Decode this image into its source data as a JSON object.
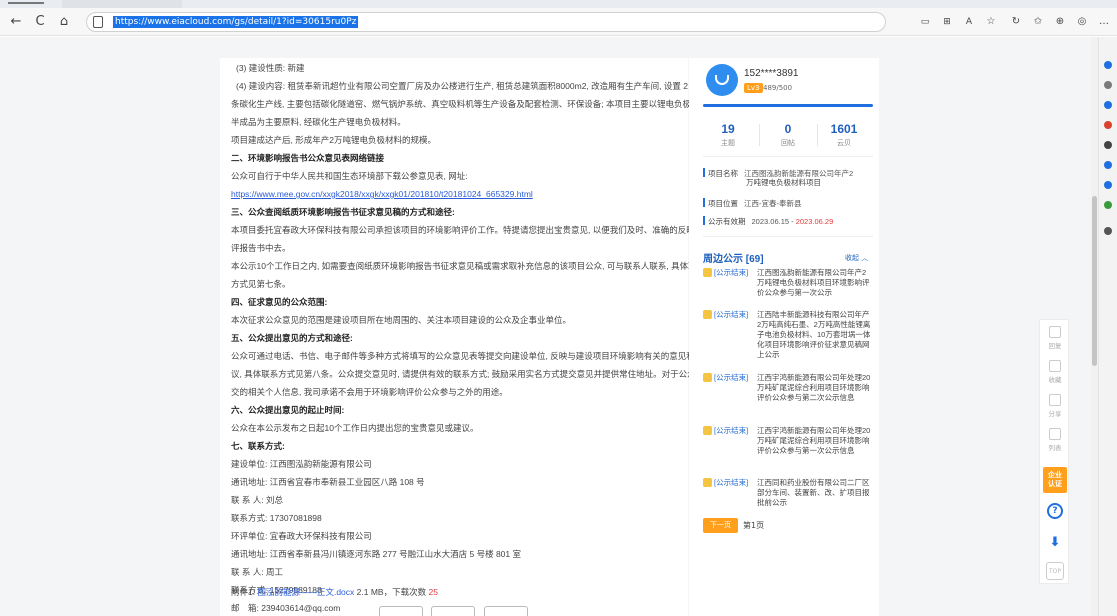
{
  "browser": {
    "url": "https://www.eiacloud.com/gs/detail/1?id=30615ru0Pz",
    "back": "←",
    "refresh": "C",
    "home": "⌂",
    "icons": [
      "reader-view-icon",
      "grid-icon",
      "read-aloud-icon",
      "favorite-star-icon",
      "refresh-ext-icon",
      "favorites-icon",
      "collections-icon",
      "more-icon"
    ]
  },
  "article": {
    "lines": [
      "(3) 建设性质: 新建",
      "(4) 建设内容: 租赁奉新讯超竹业有限公司空置厂房及办公楼进行生产, 租赁总建筑面积8000m2, 改造厢有生产车间, 设置 2",
      "条碳化生产线, 主要包括碳化隧道窑、燃气锅炉系统、真空吸料机等生产设备及配套检测、环保设备; 本项目主要以锂电负极材料",
      "半成品为主要原料, 经碳化生产锂电负极材料。",
      "项目建成达产后, 形成年产2万吨锂电负极材料的规模。",
      "二、环境影响报告书公众意见表网络链接",
      "公众可自行于中华人民共和国生态环境部下载公参意见表, 网址:",
      "https://www.mee.gov.cn/xxgk2018/xxgk/xxgk01/201810/t20181024_665329.html",
      "三、公众查阅纸质环境影响报告书征求意见稿的方式和途径:",
      "本项目委托宜春政大环保科技有限公司承担该项目的环境影响评价工作。特提请您提出宝贵意见, 以便我们及时、准确的反映到环",
      "评报告书中去。",
      "本公示10个工作日之内, 如需要查阅纸质环境影响报告书征求意见稿或需求取补充信息的该项目公众, 可与联系人联系, 具体联系",
      "方式见第七条。",
      "四、征求意见的公众范围:",
      "本次征求公众意见的范围是建设项目所在地周围的、关注本项目建设的公众及企事业单位。",
      "五、公众提出意见的方式和途径:",
      "公众可通过电话、书信、电子邮件等多种方式将填写的公众意见表等提交向建设单位, 反映与建设项目环境影响有关的意见和建",
      "议, 具体联系方式见第八条。公众提交意见时, 请提供有效的联系方式; 鼓励采用实名方式提交意见并提供常住地址。对于公众提",
      "交的相关个人信息, 我司承诺不会用于环境影响评价公众参与之外的用途。",
      "六、公众提出意见的起止时间:",
      "公众在本公示发布之日起10个工作日内提出您的宝贵意见或建议。",
      "七、联系方式:",
      "建设单位: 江西图泓韵新能源有限公司",
      "通讯地址: 江西省宜春市奉新县工业园区八路 108 号",
      "联 系 人: 刘总",
      "联系方式: 17307081898",
      "环评单位: 宜春政大环保科技有限公司",
      "通讯地址: 江西省奉新县冯川镇逐河东路 277 号融江山水大酒店 5 号楼 801 室",
      "联 系 人: 周工",
      "联系方式: 15279589188",
      "邮　箱: 239403614@qq.com"
    ],
    "attachment": {
      "prefix": "附件1:",
      "filename": "图泓韵能源——正文.docx",
      "meta": "2.1 MB，下载次数",
      "downloads": "25"
    }
  },
  "panel": {
    "username": "152****3891",
    "level": "Lv3",
    "score": "489/500",
    "stats": [
      {
        "num": "19",
        "label": "主题"
      },
      {
        "num": "0",
        "label": "回帖"
      },
      {
        "num": "1601",
        "label": "云贝"
      }
    ],
    "info": {
      "name_key": "项目名称",
      "name_val_1": "江西图泓韵新能源有限公司年产2",
      "name_val_2": "万吨锂电负极材料项目",
      "loc_key": "项目位置",
      "loc_val": "江西-宜春-奉新县",
      "period_key": "公示有效期",
      "period_start": "2023.06.15 - ",
      "period_end": "2023.06.29"
    },
    "nearby": {
      "title": "周边公示 [69]",
      "collapse": "收起 ︿",
      "tag": "[公示结束]",
      "items": [
        "江西图泓韵新能源有限公司年产2万吨锂电负极材料项目环境影响评价公众参与第一次公示",
        "江西陆丰新能源科技有限公司年产2万吨高纯石墨、2万吨高性能锂离子电池负极材料、10万套坩埚一体化项目环境影响评价征求意见稿网上公示",
        "江西宇鸿新能源有限公司年处理20万吨矿尾泥综合利用项目环境影响评价公众参与第二次公示信息",
        "江西宇鸿新能源有限公司年处理20万吨矿尾泥综合利用项目环境影响评价公众参与第一次公示信息",
        "江西同和药业股份有限公司二厂区部分车间、装置新、改、扩项目报批前公示"
      ],
      "next": "下一页",
      "page": "第1页"
    }
  },
  "float": {
    "reply": "回复",
    "fav": "收藏",
    "share": "分享",
    "list": "列表",
    "cert_1": "企业",
    "cert_2": "认证",
    "help": "?",
    "download": "⬇",
    "top": "TOP"
  }
}
